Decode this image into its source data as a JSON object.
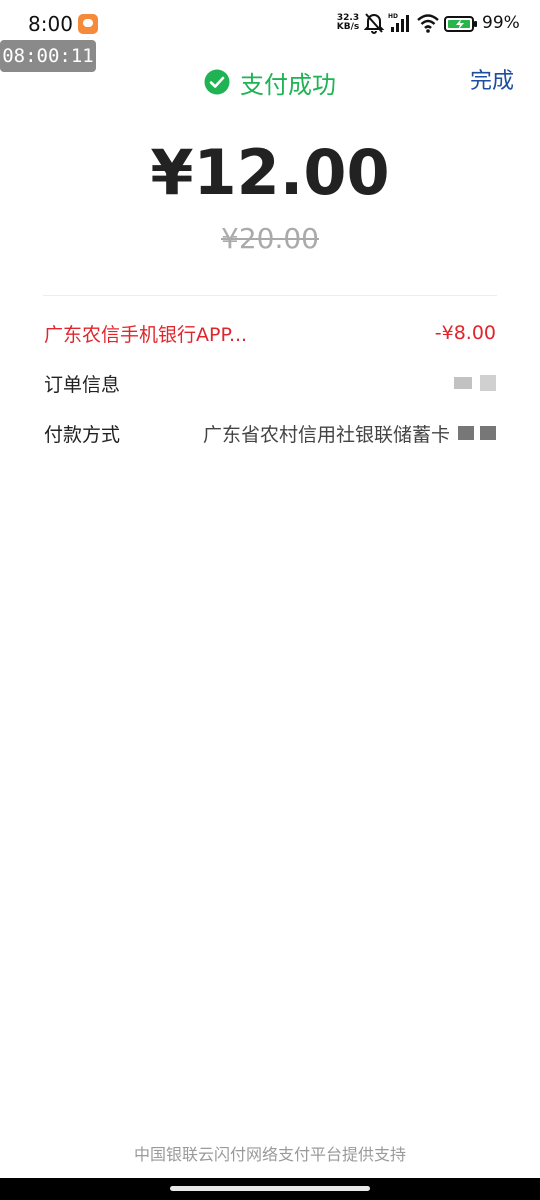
{
  "status_bar": {
    "time": "8:00",
    "net_speed_value": "32.3",
    "net_speed_unit": "KB/s",
    "battery_percent": "99%",
    "icons": [
      "app-notification-icon",
      "bell-muted-icon",
      "signal-icon",
      "wifi-icon",
      "battery-icon"
    ]
  },
  "timer_overlay": "08:00:11",
  "header": {
    "title": "支付成功",
    "done_label": "完成",
    "accent_color": "#1fb354",
    "link_color": "#1d4e9f"
  },
  "payment": {
    "amount": "¥12.00",
    "original_amount": "¥20.00"
  },
  "details": {
    "discount_label": "广东农信手机银行APP...",
    "discount_value": "-¥8.00",
    "discount_color": "#e0262d",
    "order_label": "订单信息",
    "payment_method_label": "付款方式",
    "payment_method_value": "广东省农村信用社银联储蓄卡"
  },
  "footer": {
    "text": "中国银联云闪付网络支付平台提供支持"
  }
}
